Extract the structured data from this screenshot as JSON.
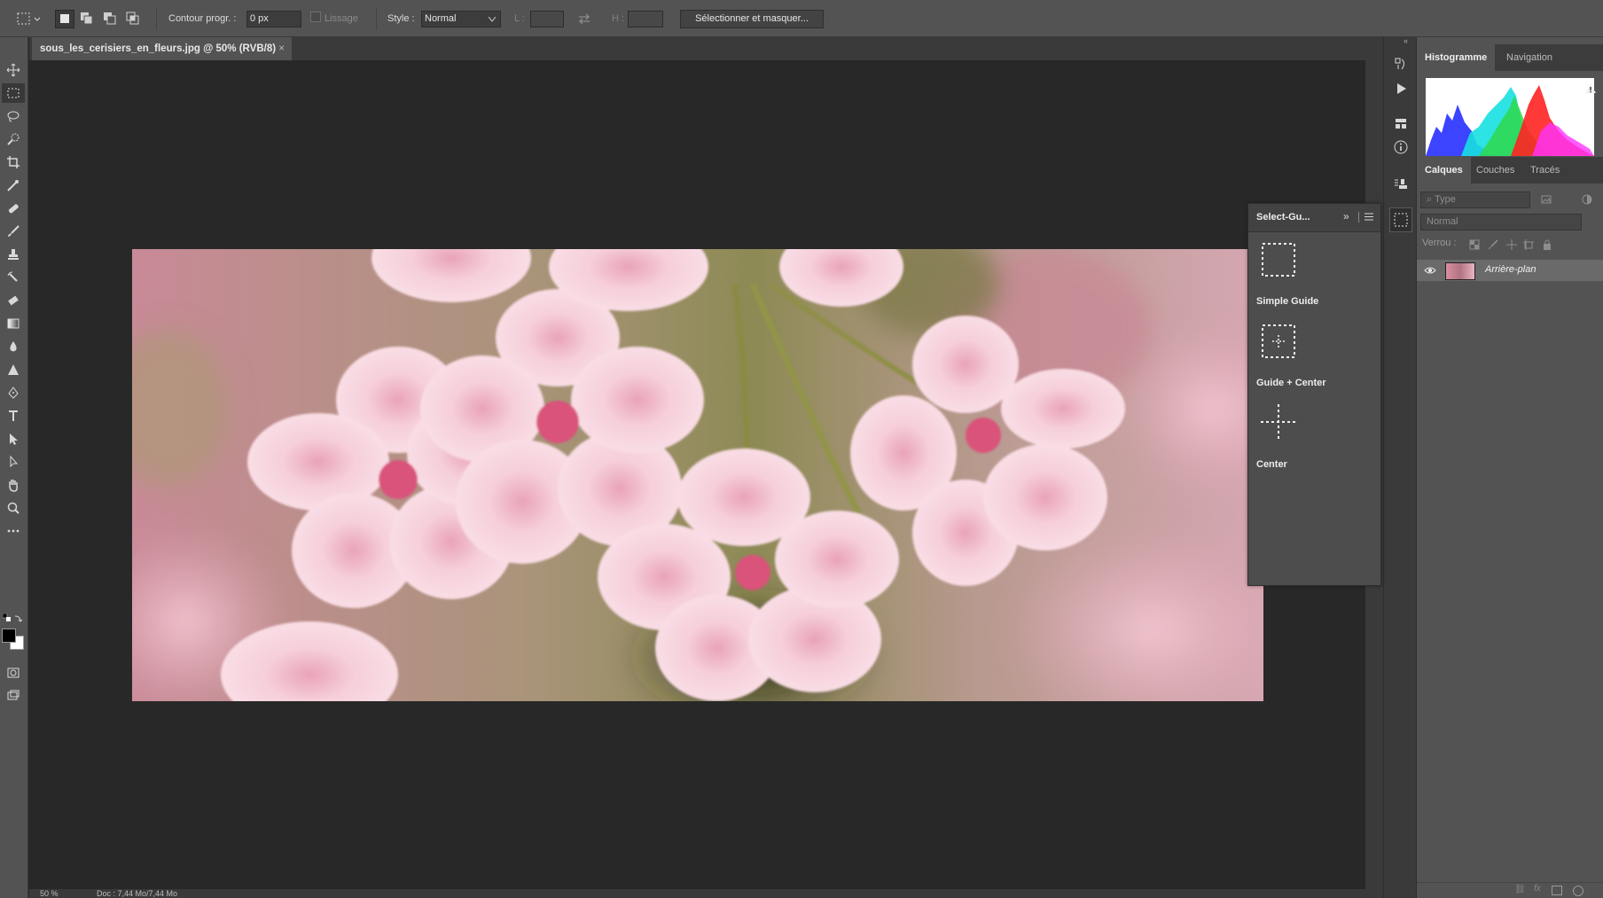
{
  "options_bar": {
    "feather_label": "Contour progr. :",
    "feather_value": "0 px",
    "antialias_label": "Lissage",
    "style_label": "Style :",
    "style_value": "Normal",
    "width_label": "L :",
    "height_label": "H :",
    "select_mask_button": "Sélectionner et masquer..."
  },
  "document": {
    "tab_title": "sous_les_cerisiers_en_fleurs.jpg @ 50% (RVB/8)",
    "close_glyph": "×"
  },
  "status_bar": {
    "zoom": "50 %",
    "doc_info": "Doc : 7,44 Mo/7,44 Mo"
  },
  "select_guide_panel": {
    "title": "Select-Gu...",
    "items": [
      {
        "label": "Simple Guide",
        "icon": "dashed-rect-icon"
      },
      {
        "label": "Guide + Center",
        "icon": "dashed-rect-center-icon"
      },
      {
        "label": "Center",
        "icon": "crosshair-icon"
      }
    ]
  },
  "right_panel": {
    "top_tabs": [
      "Histogramme",
      "Navigation"
    ],
    "layer_tabs": [
      "Calques",
      "Couches",
      "Tracés"
    ],
    "filter_placeholder": "Type",
    "blend_mode": "Normal",
    "lock_label": "Verrou :",
    "layers": [
      {
        "name": "Arrière-plan",
        "visible": true
      }
    ]
  },
  "colors": {
    "ui_dark": "#282828",
    "panel": "#535353",
    "foreground": "#000000",
    "background": "#ffffff"
  }
}
